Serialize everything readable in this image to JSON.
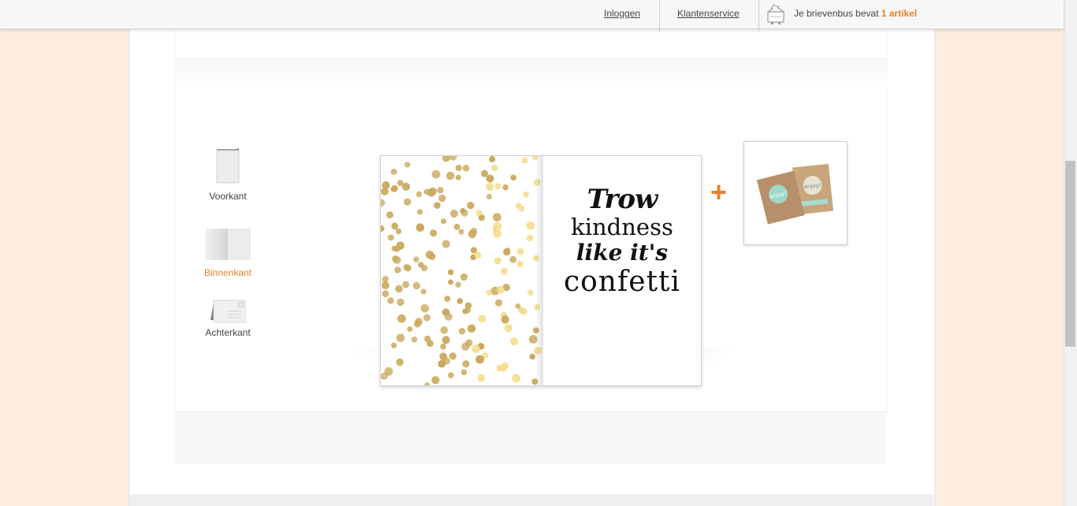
{
  "header": {
    "login_label": "Inloggen",
    "service_label": "Klantenservice",
    "cart_text": "Je brievenbus bevat",
    "cart_count": "1 artikel",
    "cart_icon": "mailbox-icon"
  },
  "side_nav": {
    "items": [
      {
        "label": "Voorkant",
        "icon": "card-front-icon"
      },
      {
        "label": "Binnenkant",
        "icon": "card-inside-icon",
        "active": true
      },
      {
        "label": "Achterkant",
        "icon": "envelope-icon"
      }
    ]
  },
  "card": {
    "quote_lines": [
      "Trow",
      "kindness",
      "like it's",
      "confetti"
    ]
  },
  "gift": {
    "plus_sign": "+",
    "box_label": "enjoy!"
  },
  "colors": {
    "accent": "#e8822a",
    "background": "#fdeee0",
    "confetti": "#c9a85c"
  }
}
